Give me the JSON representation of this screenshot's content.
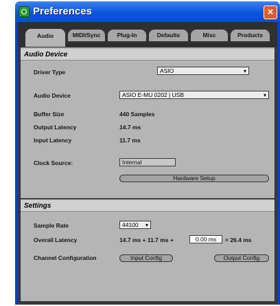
{
  "window": {
    "title": "Preferences",
    "close_glyph": "×"
  },
  "icons": {
    "app": "app-icon",
    "close": "close-icon",
    "dropdown_arrow": "chevron-down-icon"
  },
  "tabs": [
    {
      "label": "Audio",
      "active": true
    },
    {
      "label": "MIDI/Sync",
      "active": false
    },
    {
      "label": "Plug-In",
      "active": false
    },
    {
      "label": "Defaults",
      "active": false
    },
    {
      "label": "Misc",
      "active": false
    },
    {
      "label": "Products",
      "active": false
    }
  ],
  "audio_device": {
    "header": "Audio Device",
    "driver_type": {
      "label": "Driver Type",
      "value": "ASIO"
    },
    "device": {
      "label": "Audio Device",
      "value": "ASIO E-MU 0202 | USB"
    },
    "buffer_size": {
      "label": "Buffer Size",
      "value": "440 Samples"
    },
    "output_latency": {
      "label": "Output Latency",
      "value": "14.7 ms"
    },
    "input_latency": {
      "label": "Input Latency",
      "value": "11.7 ms"
    },
    "clock_source": {
      "label": "Clock Source:",
      "value": "Internal"
    },
    "hardware_setup_label": "Hardware Setup"
  },
  "settings": {
    "header": "Settings",
    "sample_rate": {
      "label": "Sample Rate",
      "value": "44100"
    },
    "overall_latency": {
      "label": "Overall Latency",
      "prefix": "14.7 ms + 11.7 ms +",
      "input_value": "0.00 ms",
      "suffix": "= 26.4 ms"
    },
    "channel_config": {
      "label": "Channel Configuration",
      "input_button": "Input Config",
      "output_button": "Output Config"
    }
  },
  "colors": {
    "titlebar": "#0a55dc",
    "close_button": "#e05b2a",
    "panel": "#b5b5b5",
    "dark_frame": "#3a3a3a"
  }
}
